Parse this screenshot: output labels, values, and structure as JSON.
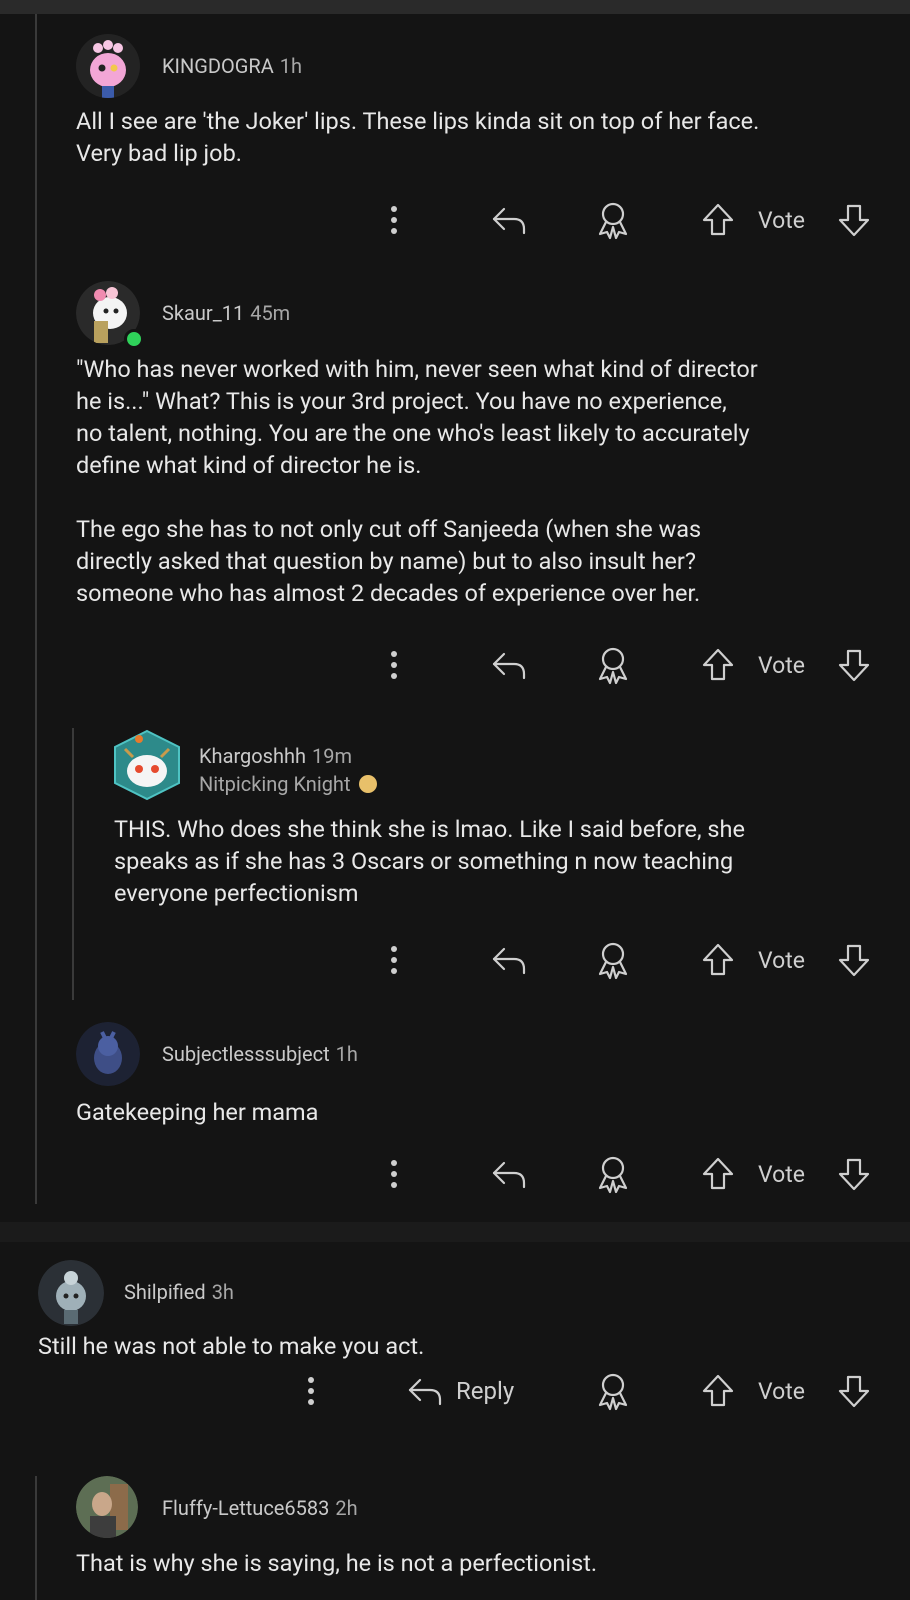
{
  "actions": {
    "vote_label": "Vote",
    "reply_label": "Reply"
  },
  "comments": [
    {
      "user": "KINGDOGRA",
      "time": "1h",
      "body": "All I see are 'the Joker' lips. These lips kinda sit on top of her face.\nVery bad lip job."
    },
    {
      "user": "Skaur_11",
      "time": "45m",
      "body": "\"Who has never worked with him, never seen what kind of director\nhe is...\" What? This is your 3rd project. You have no experience,\nno talent, nothing. You are the one who's least likely to accurately\ndefine what kind of director he is.\n\nThe ego she has to not only cut off Sanjeeda (when she was\ndirectly asked that question by name) but to also insult her?\nsomeone who has almost 2 decades of experience over her."
    },
    {
      "user": "Khargoshhh",
      "time": "19m",
      "flair": "Nitpicking Knight",
      "body": "THIS. Who does she think she is lmao. Like I said before, she\nspeaks as if she has 3 Oscars or something n now teaching\neveryone perfectionism"
    },
    {
      "user": "Subjectlesssubject",
      "time": "1h",
      "body": "Gatekeeping her mama"
    },
    {
      "user": "Shilpified",
      "time": "3h",
      "body": "Still he was not able to make you act."
    },
    {
      "user": "Fluffy-Lettuce6583",
      "time": "2h",
      "body": "That is why she is saying, he is not a perfectionist."
    }
  ],
  "icons": {
    "more": "more-options-icon",
    "reply": "reply-arrow-icon",
    "award": "award-icon",
    "upvote": "upvote-arrow-icon",
    "downvote": "downvote-arrow-icon"
  },
  "colors": {
    "background": "#141414",
    "thread_line": "#3a3a3a",
    "online": "#2fd15a",
    "text": "#e8e8e8",
    "meta": "#a7a7a7"
  }
}
